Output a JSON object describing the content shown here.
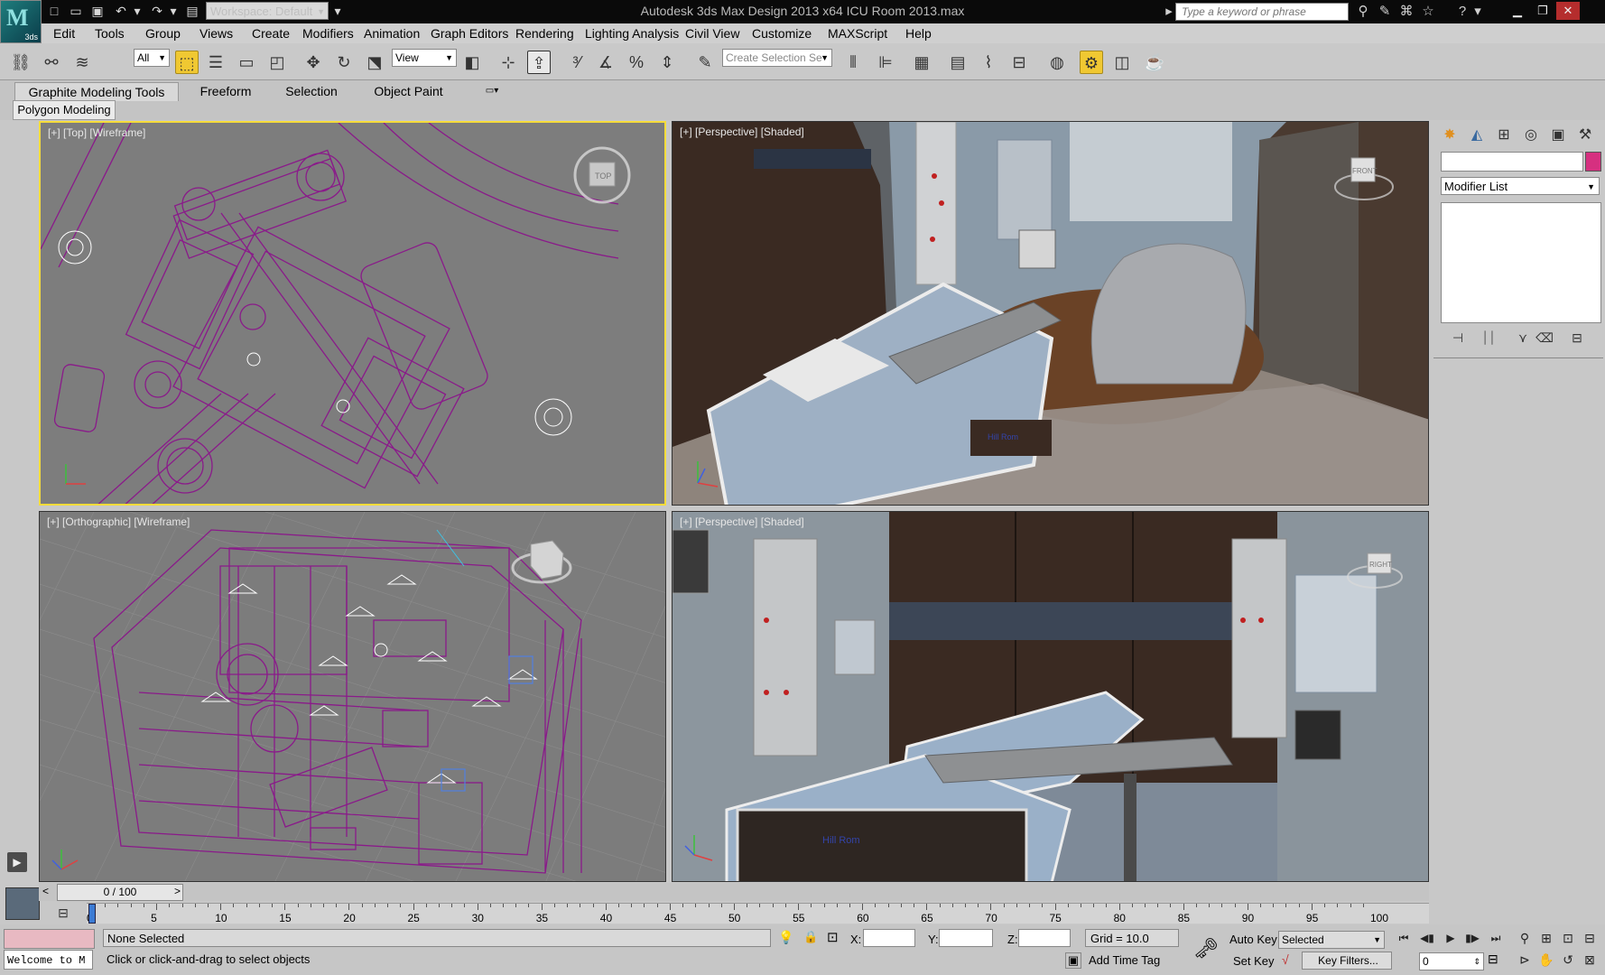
{
  "app": {
    "logo_text": "3ds",
    "window_title": "Autodesk 3ds Max Design 2013 x64     ICU Room 2013.max",
    "workspace": "Workspace: Default",
    "search_placeholder": "Type a keyword or phrase"
  },
  "menu": [
    "Edit",
    "Tools",
    "Group",
    "Views",
    "Create",
    "Modifiers",
    "Animation",
    "Graph Editors",
    "Rendering",
    "Lighting Analysis",
    "Civil View",
    "Customize",
    "MAXScript",
    "Help"
  ],
  "toolbar": {
    "filter_value": "All",
    "reference_coord": "View",
    "selection_set_placeholder": "Create Selection Se"
  },
  "ribbon": {
    "tabs": [
      "Graphite Modeling Tools",
      "Freeform",
      "Selection",
      "Object Paint"
    ],
    "panel": "Polygon Modeling"
  },
  "viewports": {
    "top_left": "[+] [Top] [Wireframe]",
    "top_right": "[+] [Perspective] [Shaded]",
    "bottom_left": "[+] [Orthographic] [Wireframe]",
    "bottom_right": "[+] [Perspective] [Shaded]",
    "viewcube_top": "TOP",
    "viewcube_front": "FRONT",
    "viewcube_right": "RIGHT",
    "bed_brand": "Hill Rom"
  },
  "command_panel": {
    "modifier_list": "Modifier List",
    "color_swatch": "#d63080"
  },
  "timeline": {
    "frame_display": "0 / 100",
    "prev_label": "<",
    "next_label": ">",
    "ticks": [
      "0",
      "5",
      "10",
      "15",
      "20",
      "25",
      "30",
      "35",
      "40",
      "45",
      "50",
      "55",
      "60",
      "65",
      "70",
      "75",
      "80",
      "85",
      "90",
      "95",
      "100"
    ]
  },
  "status": {
    "maxscript_listener": "Welcome to M",
    "selection": "None Selected",
    "prompt": "Click or click-and-drag to select objects",
    "x_label": "X:",
    "y_label": "Y:",
    "z_label": "Z:",
    "grid": "Grid = 10.0",
    "add_time_tag": "Add Time Tag",
    "auto_key": "Auto Key",
    "set_key": "Set Key",
    "key_mode": "Selected",
    "key_filters": "Key Filters...",
    "current_frame": "0"
  },
  "colors": {
    "active_viewport_border": "#f6dc3a",
    "wireframe": "#8a1a8a",
    "accent_tool": "#f0c832"
  }
}
